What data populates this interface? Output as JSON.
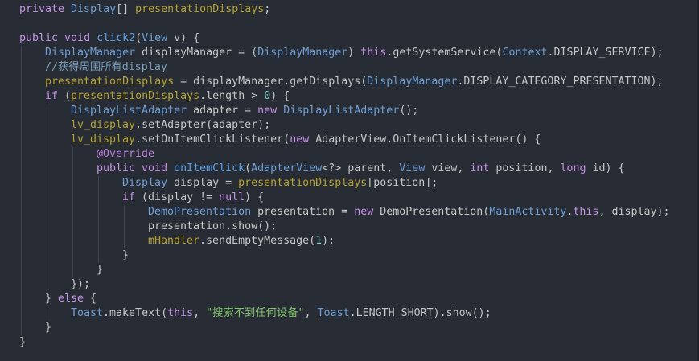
{
  "editor": {
    "lines": [
      [
        {
          "t": "private ",
          "c": "pp"
        },
        {
          "t": "Display",
          "c": "ty"
        },
        {
          "t": "[] ",
          "c": "pl"
        },
        {
          "t": "presentationDisplays",
          "c": "fld"
        },
        {
          "t": ";",
          "c": "pl"
        }
      ],
      [],
      [
        {
          "t": "public ",
          "c": "pp"
        },
        {
          "t": "void ",
          "c": "pp"
        },
        {
          "t": "click2",
          "c": "fn"
        },
        {
          "t": "(",
          "c": "pl"
        },
        {
          "t": "View ",
          "c": "ty"
        },
        {
          "t": "v) {",
          "c": "pl"
        }
      ],
      [
        {
          "t": "DisplayManager ",
          "c": "ty"
        },
        {
          "t": "displayManager = (",
          "c": "pl"
        },
        {
          "t": "DisplayManager",
          "c": "ty"
        },
        {
          "t": ") ",
          "c": "pl"
        },
        {
          "t": "this",
          "c": "pp"
        },
        {
          "t": ".getSystemService(",
          "c": "pl"
        },
        {
          "t": "Context",
          "c": "ty"
        },
        {
          "t": ".DISPLAY_SERVICE);",
          "c": "pl"
        }
      ],
      [
        {
          "t": "//获得周围所有display",
          "c": "cmt"
        }
      ],
      [
        {
          "t": "presentationDisplays",
          "c": "fld"
        },
        {
          "t": " = displayManager.getDisplays(",
          "c": "pl"
        },
        {
          "t": "DisplayManager",
          "c": "ty"
        },
        {
          "t": ".DISPLAY_CATEGORY_PRESENTATION);",
          "c": "pl"
        }
      ],
      [
        {
          "t": "if ",
          "c": "pp"
        },
        {
          "t": "(",
          "c": "pl"
        },
        {
          "t": "presentationDisplays",
          "c": "fld"
        },
        {
          "t": ".length > ",
          "c": "pl"
        },
        {
          "t": "0",
          "c": "num"
        },
        {
          "t": ") {",
          "c": "pl"
        }
      ],
      [
        {
          "t": "DisplayListAdapter ",
          "c": "ty"
        },
        {
          "t": "adapter = ",
          "c": "pl"
        },
        {
          "t": "new ",
          "c": "pp"
        },
        {
          "t": "DisplayListAdapter",
          "c": "ty"
        },
        {
          "t": "();",
          "c": "pl"
        }
      ],
      [
        {
          "t": "lv_display",
          "c": "fld"
        },
        {
          "t": ".setAdapter(adapter);",
          "c": "pl"
        }
      ],
      [
        {
          "t": "lv_display",
          "c": "fld"
        },
        {
          "t": ".setOnItemClickListener(",
          "c": "pl"
        },
        {
          "t": "new ",
          "c": "pp"
        },
        {
          "t": "AdapterView.OnItemClickListener() {",
          "c": "pl"
        }
      ],
      [
        {
          "t": "@Override",
          "c": "ann"
        }
      ],
      [
        {
          "t": "public ",
          "c": "pp"
        },
        {
          "t": "void ",
          "c": "pp"
        },
        {
          "t": "onItemClick",
          "c": "fn"
        },
        {
          "t": "(",
          "c": "pl"
        },
        {
          "t": "AdapterView",
          "c": "ty"
        },
        {
          "t": "<?> parent, ",
          "c": "pl"
        },
        {
          "t": "View ",
          "c": "ty"
        },
        {
          "t": "view, ",
          "c": "pl"
        },
        {
          "t": "int ",
          "c": "pp"
        },
        {
          "t": "position, ",
          "c": "pl"
        },
        {
          "t": "long ",
          "c": "pp"
        },
        {
          "t": "id) {",
          "c": "pl"
        }
      ],
      [
        {
          "t": "Display ",
          "c": "ty"
        },
        {
          "t": "display = ",
          "c": "pl"
        },
        {
          "t": "presentationDisplays",
          "c": "fld"
        },
        {
          "t": "[position];",
          "c": "pl"
        }
      ],
      [
        {
          "t": "if ",
          "c": "pp"
        },
        {
          "t": "(display != ",
          "c": "pl"
        },
        {
          "t": "null",
          "c": "pp"
        },
        {
          "t": ") {",
          "c": "pl"
        }
      ],
      [
        {
          "t": "DemoPresentation ",
          "c": "ty"
        },
        {
          "t": "presentation = ",
          "c": "pl"
        },
        {
          "t": "new ",
          "c": "pp"
        },
        {
          "t": "DemoPresentation(",
          "c": "pl"
        },
        {
          "t": "MainActivity",
          "c": "ty"
        },
        {
          "t": ".",
          "c": "pl"
        },
        {
          "t": "this",
          "c": "pp"
        },
        {
          "t": ", display);",
          "c": "pl"
        }
      ],
      [
        {
          "t": "presentation.show();",
          "c": "pl"
        }
      ],
      [
        {
          "t": "mHandler",
          "c": "fld"
        },
        {
          "t": ".sendEmptyMessage(",
          "c": "pl"
        },
        {
          "t": "1",
          "c": "num"
        },
        {
          "t": ");",
          "c": "pl"
        }
      ],
      [
        {
          "t": "}",
          "c": "pl"
        }
      ],
      [
        {
          "t": "}",
          "c": "pl"
        }
      ],
      [
        {
          "t": "});",
          "c": "pl"
        }
      ],
      [
        {
          "t": "} ",
          "c": "pl"
        },
        {
          "t": "else ",
          "c": "pp"
        },
        {
          "t": "{",
          "c": "pl"
        }
      ],
      [
        {
          "t": "Toast",
          "c": "ty"
        },
        {
          "t": ".makeText(",
          "c": "pl"
        },
        {
          "t": "this",
          "c": "pp"
        },
        {
          "t": ", ",
          "c": "pl"
        },
        {
          "t": "\"搜索不到任何设备\"",
          "c": "str"
        },
        {
          "t": ", ",
          "c": "pl"
        },
        {
          "t": "Toast",
          "c": "ty"
        },
        {
          "t": ".LENGTH_SHORT).show();",
          "c": "pl"
        }
      ],
      [
        {
          "t": "}",
          "c": "pl"
        }
      ],
      [
        {
          "t": "}",
          "c": "pl"
        }
      ]
    ]
  },
  "colors": {
    "background": "#282c34",
    "keyword": "#c792ea",
    "type": "#6f9fd8",
    "field": "#b7a32c",
    "string": "#80c46a",
    "comment": "#7aa0bc"
  }
}
